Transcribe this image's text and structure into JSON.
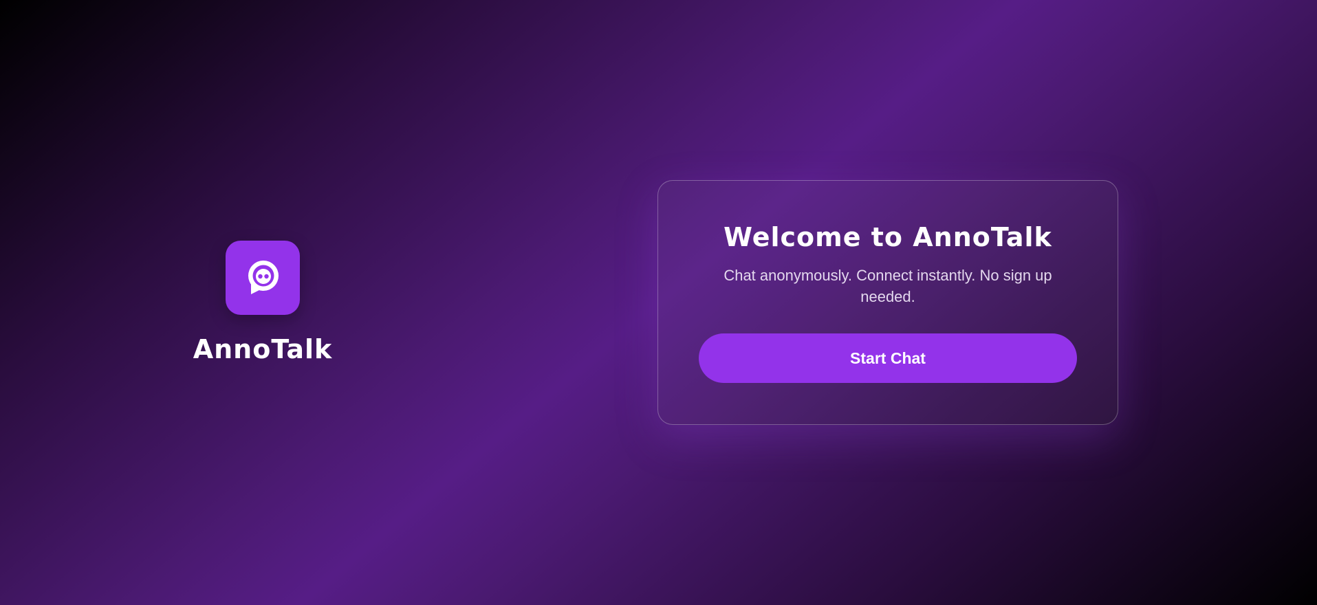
{
  "brand": {
    "name": "AnnoTalk",
    "icon": "chat-bubble-icon",
    "accent_color": "#9333ea"
  },
  "welcome": {
    "title": "Welcome to AnnoTalk",
    "subtitle": "Chat anonymously. Connect instantly. No sign up needed.",
    "button_label": "Start Chat"
  }
}
